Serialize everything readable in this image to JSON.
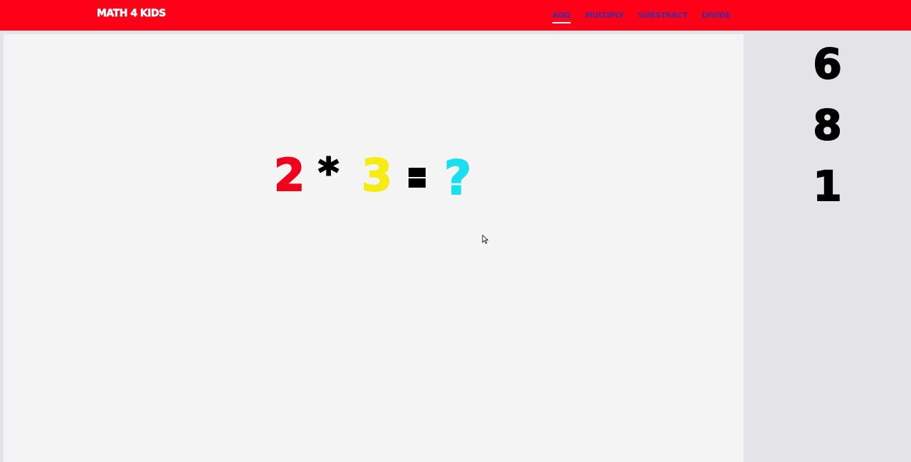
{
  "navbar": {
    "brand": "MATH 4 KIDS",
    "links": [
      {
        "label": "ADD",
        "active": true
      },
      {
        "label": "MULTIPLY",
        "active": false
      },
      {
        "label": "SUBSTRACT",
        "active": false
      },
      {
        "label": "DIVIDE",
        "active": false
      }
    ]
  },
  "equation": {
    "operand1": "2",
    "operator": "*",
    "operand2": "3",
    "unknown": "?"
  },
  "answers": [
    "6",
    "8",
    "1"
  ],
  "colors": {
    "navbar": "#ff0019",
    "operand1": "#f0001a",
    "operand2": "#f7ec12",
    "unknown": "#19e0f0"
  }
}
